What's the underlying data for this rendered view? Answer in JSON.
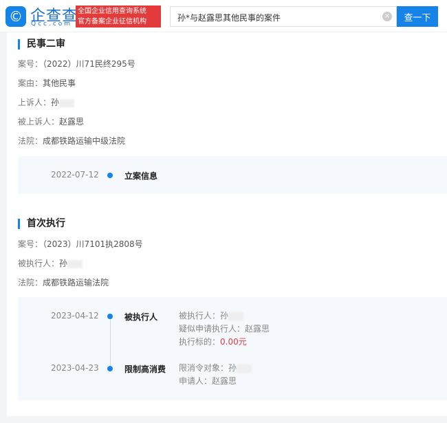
{
  "header": {
    "logo_text": "企查查",
    "logo_sub": "Qcc.com",
    "slogan_1": "全国企业信用查询系统",
    "slogan_2": "官方备案企业征信机构",
    "search_value": "孙*与赵露思其他民事的案件",
    "search_button": "查一下"
  },
  "s1": {
    "title": "民事二审",
    "rows": [
      {
        "label": "案号：",
        "value": "（2022）川71民终295号"
      },
      {
        "label": "案由：",
        "value": "其他民事"
      },
      {
        "label": "上诉人：",
        "value": "孙"
      },
      {
        "label": "被上诉人：",
        "value": "赵露思"
      },
      {
        "label": "法院：",
        "value": "成都铁路运输中级法院"
      }
    ],
    "timeline": [
      {
        "date": "2022-07-12",
        "event": "立案信息"
      }
    ]
  },
  "s2": {
    "title": "首次执行",
    "rows": [
      {
        "label": "案号：",
        "value": "（2023）川7101执2808号"
      },
      {
        "label": "被执行人：",
        "value": "孙"
      },
      {
        "label": "法院：",
        "value": "成都铁路运输法院"
      }
    ],
    "timeline": [
      {
        "date": "2023-04-12",
        "event": "被执行人",
        "details": [
          "被执行人：孙",
          "疑似申请执行人：赵露思",
          "执行标的："
        ],
        "amount": "0.00元"
      },
      {
        "date": "2023-04-23",
        "event": "限制高消费",
        "details": [
          "限消令对象：孙",
          "申请人：赵露思"
        ]
      }
    ]
  }
}
